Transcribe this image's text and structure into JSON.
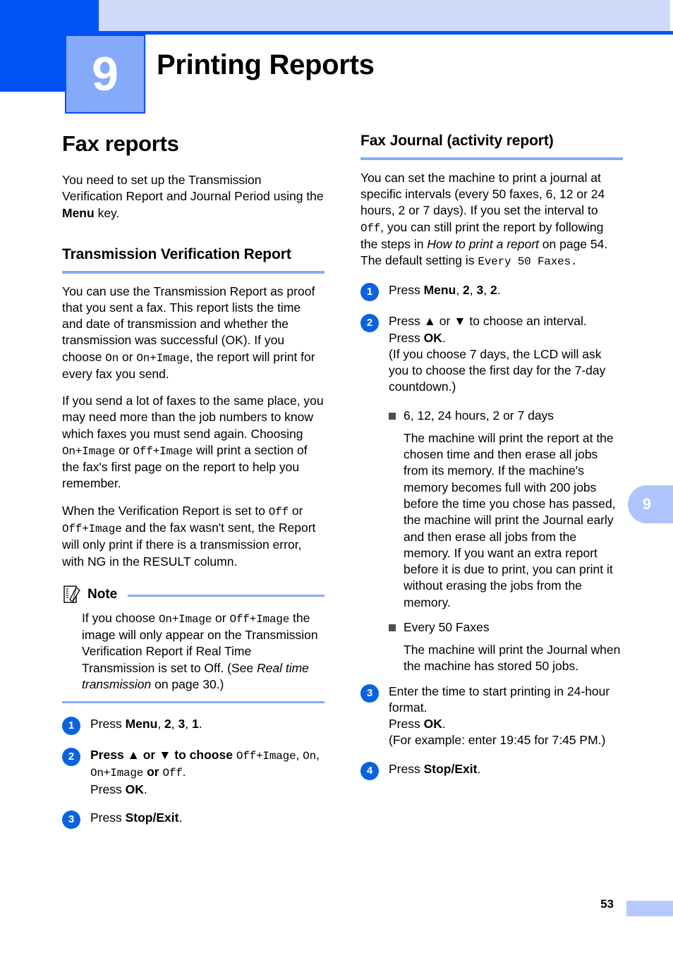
{
  "chapter": {
    "number": "9",
    "title": "Printing Reports"
  },
  "side_tab": {
    "number": "9"
  },
  "footer": {
    "page_number": "53"
  },
  "left_column": {
    "section_title": "Fax reports",
    "intro": {
      "part1": "You need to set up the Transmission Verification Report and Journal Period using the ",
      "bold_menu": "Menu",
      "part2": " key."
    },
    "subsection_title": "Transmission Verification Report",
    "para1": {
      "part1": "You can use the Transmission Report as proof that you sent a fax. This report lists the time and date of transmission and whether the transmission was successful (OK). If you choose ",
      "mono1": "On",
      "part2": " or ",
      "mono2": "On+Image",
      "part3": ", the report will print for every fax you send."
    },
    "para2": {
      "part1": "If you send a lot of faxes to the same place, you may need more than the job numbers to know which faxes you must send again. Choosing ",
      "mono1": "On+Image",
      "part2": " or ",
      "mono2": "Off+Image",
      "part3": " will print a section of the fax's first page on the report to help you remember."
    },
    "para3": {
      "part1": "When the Verification Report is set to ",
      "mono1": "Off",
      "part2": " or ",
      "mono2": "Off+Image",
      "part3": " and the fax wasn't sent, the Report will only print if there is a transmission error, with NG in the RESULT column."
    },
    "note": {
      "label": "Note",
      "part1": "If you choose ",
      "mono1": "On+Image",
      "part2": " or ",
      "mono2": "Off+Image",
      "part3": " the image will only appear on the Transmission Verification Report if Real Time Transmission is set to Off. (See ",
      "italic1": "Real time transmission",
      "part4": " on page 30.)"
    },
    "steps": [
      {
        "number": "1",
        "segments": [
          {
            "t": "Press ",
            "style": "plain"
          },
          {
            "t": "Menu",
            "style": "bold"
          },
          {
            "t": ", ",
            "style": "plain"
          },
          {
            "t": "2",
            "style": "bold"
          },
          {
            "t": ", ",
            "style": "plain"
          },
          {
            "t": "3",
            "style": "bold"
          },
          {
            "t": ", ",
            "style": "plain"
          },
          {
            "t": "1",
            "style": "bold"
          },
          {
            "t": ".",
            "style": "plain"
          }
        ]
      },
      {
        "number": "2",
        "segments": [
          {
            "t": "Press ",
            "style": "bold"
          },
          {
            "t": "▲",
            "style": "bold"
          },
          {
            "t": " or ",
            "style": "bold"
          },
          {
            "t": "▼",
            "style": "bold"
          },
          {
            "t": " to choose ",
            "style": "bold"
          },
          {
            "t": "Off+Image",
            "style": "mono"
          },
          {
            "t": ", ",
            "style": "plain"
          },
          {
            "t": "On",
            "style": "mono"
          },
          {
            "t": ", ",
            "style": "plain"
          },
          {
            "t": "On+Image",
            "style": "mono"
          },
          {
            "t": " or ",
            "style": "bold"
          },
          {
            "t": "Off",
            "style": "mono"
          },
          {
            "t": ".",
            "style": "plain"
          },
          {
            "t": "\n",
            "style": "break"
          },
          {
            "t": "Press ",
            "style": "plain"
          },
          {
            "t": "OK",
            "style": "bold"
          },
          {
            "t": ".",
            "style": "plain"
          }
        ]
      },
      {
        "number": "3",
        "segments": [
          {
            "t": "Press ",
            "style": "plain"
          },
          {
            "t": "Stop/Exit",
            "style": "bold"
          },
          {
            "t": ".",
            "style": "plain"
          }
        ]
      }
    ]
  },
  "right_column": {
    "subsection_title": "Fax Journal (activity report)",
    "para1": {
      "part1": "You can set the machine to print a journal at specific intervals (every 50 faxes, 6, 12 or 24 hours, 2 or 7 days). If you set the interval to ",
      "mono1": "Off",
      "part2": ", you can still print the report by following the steps in ",
      "italic1": "How to print a report",
      "part3": " on page 54. The default setting is ",
      "mono2": "Every 50 Faxes."
    },
    "steps": [
      {
        "number": "1",
        "segments": [
          {
            "t": "Press ",
            "style": "plain"
          },
          {
            "t": "Menu",
            "style": "bold"
          },
          {
            "t": ", ",
            "style": "plain"
          },
          {
            "t": "2",
            "style": "bold"
          },
          {
            "t": ", ",
            "style": "plain"
          },
          {
            "t": "3",
            "style": "bold"
          },
          {
            "t": ", ",
            "style": "plain"
          },
          {
            "t": "2",
            "style": "bold"
          },
          {
            "t": ".",
            "style": "plain"
          }
        ]
      },
      {
        "number": "2",
        "segments": [
          {
            "t": "Press ",
            "style": "plain"
          },
          {
            "t": "▲",
            "style": "bold"
          },
          {
            "t": " or ",
            "style": "plain"
          },
          {
            "t": "▼",
            "style": "bold"
          },
          {
            "t": " to choose an interval.",
            "style": "plain"
          },
          {
            "t": "\n",
            "style": "break"
          },
          {
            "t": "Press ",
            "style": "plain"
          },
          {
            "t": "OK",
            "style": "bold"
          },
          {
            "t": ".",
            "style": "plain"
          },
          {
            "t": "\n",
            "style": "break"
          },
          {
            "t": "(If you choose 7 days, the LCD will ask you to choose the first day for the 7-day countdown.)",
            "style": "plain"
          }
        ]
      },
      {
        "number": "3",
        "segments": [
          {
            "t": "Enter the time to start printing in 24-hour format.",
            "style": "plain"
          },
          {
            "t": "\n",
            "style": "break"
          },
          {
            "t": "Press ",
            "style": "plain"
          },
          {
            "t": "OK",
            "style": "bold"
          },
          {
            "t": ".",
            "style": "plain"
          },
          {
            "t": "\n",
            "style": "break"
          },
          {
            "t": "(For example: enter 19:45 for 7:45 PM.)",
            "style": "plain"
          }
        ]
      },
      {
        "number": "4",
        "segments": [
          {
            "t": "Press ",
            "style": "plain"
          },
          {
            "t": "Stop/Exit",
            "style": "bold"
          },
          {
            "t": ".",
            "style": "plain"
          }
        ]
      }
    ],
    "bullets": [
      {
        "head": "6, 12, 24 hours, 2 or 7 days",
        "body": "The machine will print the report at the chosen time and then erase all jobs from its memory. If the machine's memory becomes full with 200 jobs before the time you chose has passed, the machine will print the Journal early and then erase all jobs from the memory. If you want an extra report before it is due to print, you can print it without erasing the jobs from the memory."
      },
      {
        "head": "Every 50 Faxes",
        "body": "The machine will print the Journal when the machine has stored 50 jobs."
      }
    ]
  },
  "colors": {
    "brand_blue": "#0052f5",
    "light_blue_bar": "#cedcfa",
    "badge_blue": "#85aaf9",
    "step_circle": "#0a62e0",
    "rule_blue": "#85aaf9"
  }
}
